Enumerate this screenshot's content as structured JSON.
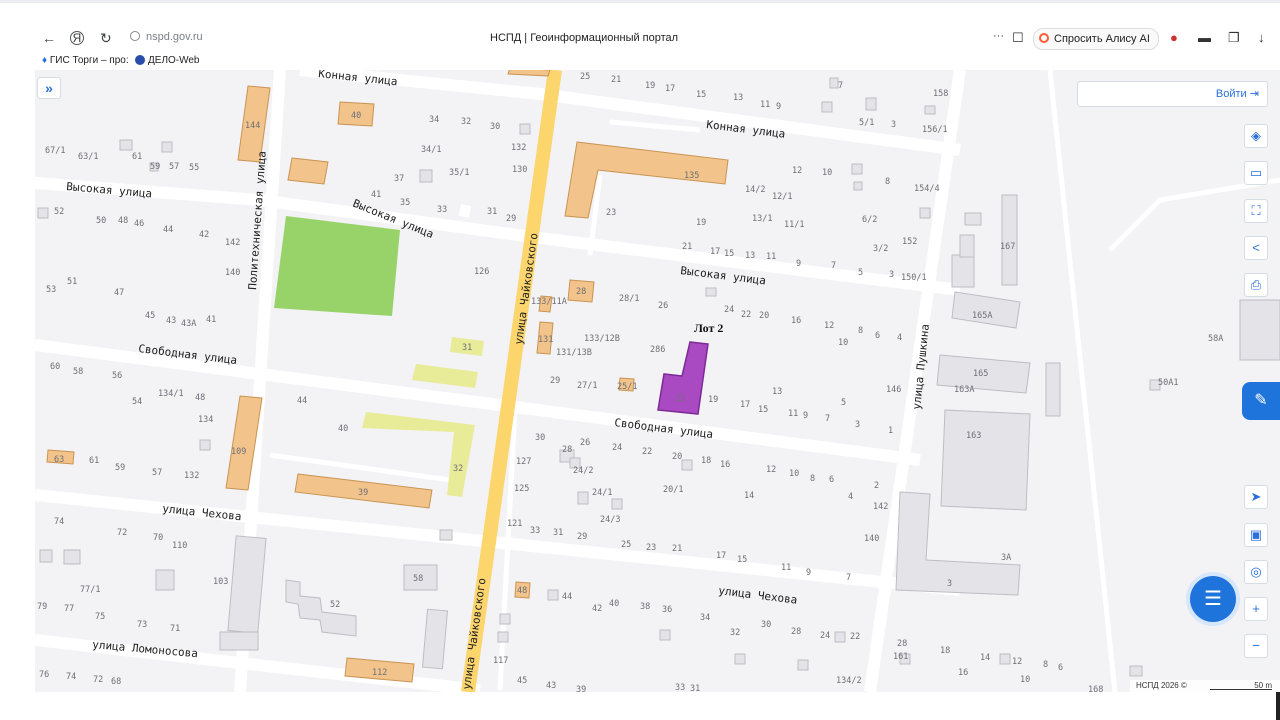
{
  "browser": {
    "url": "nspd.gov.ru",
    "title": "НСПД | Геоинформационный портал",
    "alice_label": "Спросить Алису AI",
    "menu_label": "···",
    "bookmarks": [
      "ГИС Торги – про:",
      "ДЕЛО-Web"
    ]
  },
  "map_ui": {
    "login_label": "Войти",
    "expand_label": "»",
    "attribution": "НСПД 2026 ©",
    "scale_label": "50 m",
    "zoom_in": "+",
    "zoom_out": "−"
  },
  "map": {
    "lot_label": "Лот 2",
    "streets": [
      "Конная улица",
      "Конная улица",
      "Высокая улица",
      "Высокая улица",
      "Высокая улица",
      "Свободная улица",
      "Свободная улица",
      "улица Чехова",
      "улица Чехова",
      "улица Ломоносова",
      "улица Чайковского",
      "улица Чайковского",
      "Политехническая улица",
      "улица Пушкина"
    ],
    "house_numbers": [
      "25",
      "21",
      "19",
      "17",
      "15",
      "13",
      "11",
      "9",
      "7",
      "158",
      "5/1",
      "3",
      "156/1",
      "40",
      "34",
      "32",
      "30",
      "132",
      "144",
      "67/1",
      "63/1",
      "61",
      "59",
      "57",
      "55",
      "34/1",
      "37",
      "35/1",
      "130",
      "135",
      "12",
      "10",
      "8",
      "154/4",
      "14/2",
      "12/1",
      "41",
      "35",
      "33",
      "31",
      "29",
      "23",
      "19",
      "13/1",
      "11/1",
      "6/2",
      "52",
      "50",
      "48",
      "46",
      "44",
      "42",
      "142",
      "21",
      "17",
      "15",
      "13",
      "11",
      "9",
      "7",
      "5",
      "3",
      "150/1",
      "3/2",
      "152",
      "167",
      "53",
      "51",
      "47",
      "140",
      "126",
      "133/11А",
      "28",
      "28/1",
      "26",
      "24",
      "22",
      "20",
      "16",
      "12",
      "8",
      "6",
      "4",
      "10",
      "45",
      "43",
      "43А",
      "41",
      "131",
      "133/12В",
      "131/13В",
      "286",
      "31",
      "165А",
      "165",
      "163А",
      "163",
      "146",
      "60",
      "58",
      "56",
      "54",
      "134/1",
      "48",
      "134",
      "44",
      "29",
      "27/1",
      "25/1",
      "23",
      "19",
      "17",
      "15",
      "13",
      "11",
      "9",
      "7",
      "5",
      "3",
      "1",
      "109",
      "40",
      "30",
      "28",
      "26",
      "24",
      "22",
      "20",
      "18",
      "16",
      "12",
      "10",
      "8",
      "6",
      "2",
      "4",
      "142",
      "140",
      "63",
      "61",
      "59",
      "57",
      "132",
      "32",
      "127",
      "24/2",
      "125",
      "24/1",
      "20/1",
      "14",
      "39",
      "121",
      "33",
      "31",
      "29",
      "24/3",
      "25",
      "23",
      "21",
      "17",
      "15",
      "11",
      "9",
      "7",
      "3А",
      "3",
      "74",
      "72",
      "70",
      "110",
      "103",
      "58",
      "52",
      "48",
      "44",
      "42",
      "40",
      "38",
      "36",
      "34",
      "32",
      "30",
      "28",
      "24",
      "22",
      "77/1",
      "79",
      "77",
      "75",
      "73",
      "71",
      "117",
      "45",
      "43",
      "39",
      "33",
      "31",
      "28",
      "161",
      "18",
      "16",
      "14",
      "12",
      "8",
      "6",
      "10",
      "134/2",
      "168",
      "76",
      "74",
      "72",
      "68",
      "112",
      "58А",
      "50А1"
    ]
  }
}
